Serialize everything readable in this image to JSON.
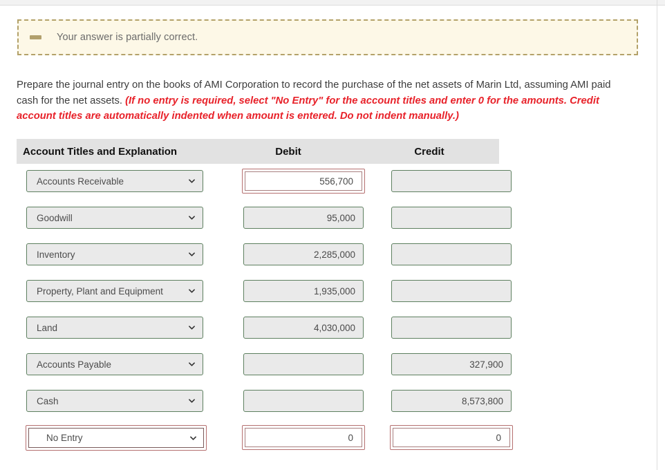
{
  "alert": {
    "icon": "minus-dash-icon",
    "message": "Your answer is partially correct."
  },
  "instructions": {
    "main": "Prepare the journal entry on the books of AMI Corporation to record the purchase of the net assets of Marin Ltd, assuming AMI paid cash for the net assets. ",
    "hint": "(If no entry is required, select \"No Entry\" for the account titles and enter 0 for the amounts. Credit account titles are automatically indented when amount is entered. Do not indent manually.)"
  },
  "table": {
    "headers": {
      "account": "Account Titles and Explanation",
      "debit": "Debit",
      "credit": "Credit"
    },
    "rows": [
      {
        "account": "Accounts Receivable",
        "debit": "556,700",
        "credit": "",
        "account_state": "normal",
        "debit_state": "error",
        "credit_state": "normal"
      },
      {
        "account": "Goodwill",
        "debit": "95,000",
        "credit": "",
        "account_state": "normal",
        "debit_state": "normal",
        "credit_state": "normal"
      },
      {
        "account": "Inventory",
        "debit": "2,285,000",
        "credit": "",
        "account_state": "normal",
        "debit_state": "normal",
        "credit_state": "normal"
      },
      {
        "account": "Property, Plant and Equipment",
        "debit": "1,935,000",
        "credit": "",
        "account_state": "normal",
        "debit_state": "normal",
        "credit_state": "normal"
      },
      {
        "account": "Land",
        "debit": "4,030,000",
        "credit": "",
        "account_state": "normal",
        "debit_state": "normal",
        "credit_state": "normal"
      },
      {
        "account": "Accounts Payable",
        "debit": "",
        "credit": "327,900",
        "account_state": "normal",
        "debit_state": "normal",
        "credit_state": "normal"
      },
      {
        "account": "Cash",
        "debit": "",
        "credit": "8,573,800",
        "account_state": "normal",
        "debit_state": "normal",
        "credit_state": "normal"
      },
      {
        "account": "No Entry",
        "debit": "0",
        "credit": "0",
        "account_state": "error",
        "debit_state": "error",
        "credit_state": "error"
      }
    ]
  },
  "colors": {
    "alert_bg": "#fdf8e7",
    "alert_border": "#b3a169",
    "hint_red": "#e8222a",
    "error_border": "#b56f6f",
    "ok_border": "#5d7f5f",
    "field_bg": "#eaeaea",
    "header_bg": "#e2e2e2"
  }
}
